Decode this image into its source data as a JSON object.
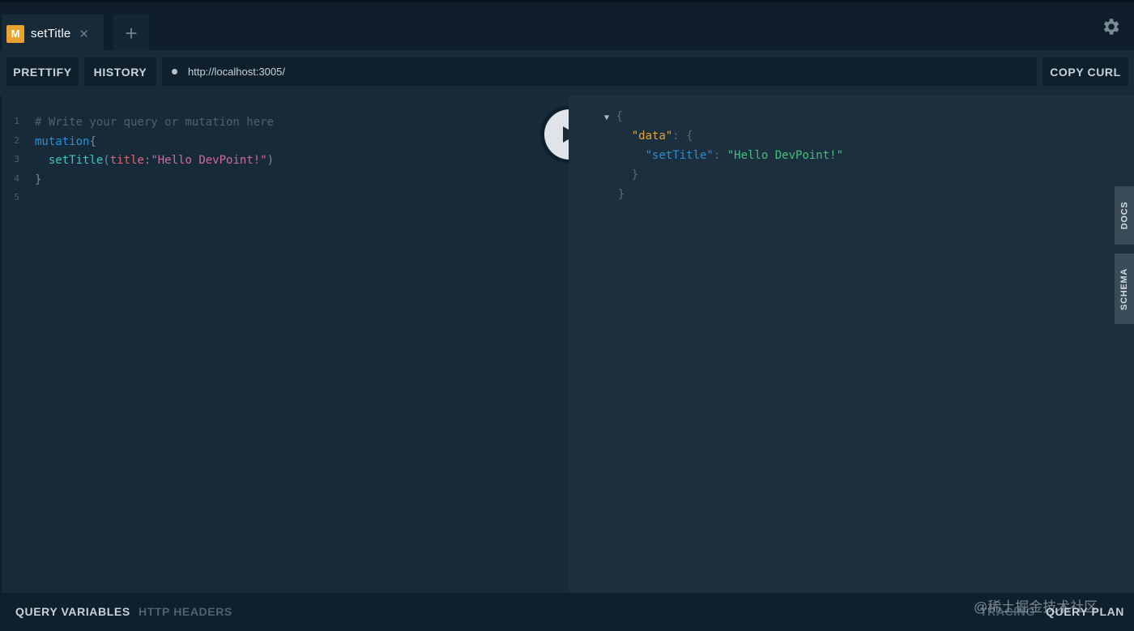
{
  "tab": {
    "badge": "M",
    "title": "setTitle",
    "close": "✕",
    "add": "+"
  },
  "toolbar": {
    "prettify": "PRETTIFY",
    "history": "HISTORY",
    "url": "http://localhost:3005/",
    "copy_curl": "COPY CURL"
  },
  "editor": {
    "line_numbers": [
      "1",
      "2",
      "3",
      "4",
      "5"
    ],
    "comment": "# Write your query or mutation here",
    "keyword": "mutation",
    "field": "setTitle",
    "arg": "title",
    "string": "\"Hello DevPoint!\""
  },
  "result": {
    "open": "{",
    "key_data": "\"data\"",
    "key_title": "\"setTitle\"",
    "value": "\"Hello DevPoint!\"",
    "close": "}"
  },
  "side": {
    "docs": "DOCS",
    "schema": "SCHEMA"
  },
  "bottom": {
    "query_variables": "QUERY VARIABLES",
    "http_headers": "HTTP HEADERS",
    "tracing": "TRACING",
    "query_plan": "QUERY PLAN"
  },
  "watermark": "@稀土掘金技术社区",
  "colors": {
    "badge": "#e8a230",
    "keyword": "#2a8fd5",
    "string_result": "#43c07c",
    "key_data": "#e8a230"
  }
}
